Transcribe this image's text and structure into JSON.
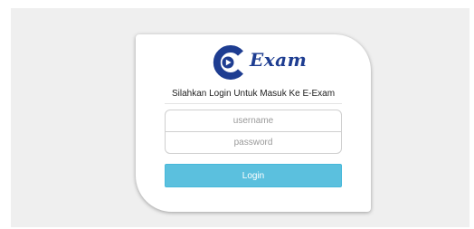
{
  "brand": {
    "name": "Exam",
    "primary_color": "#1e3d91",
    "logo_icon": "play-circle-icon"
  },
  "login": {
    "subtitle": "Silahkan Login Untuk Masuk Ke E-Exam",
    "username_placeholder": "username",
    "password_placeholder": "password",
    "button_label": "Login",
    "button_color": "#5bc0de"
  }
}
